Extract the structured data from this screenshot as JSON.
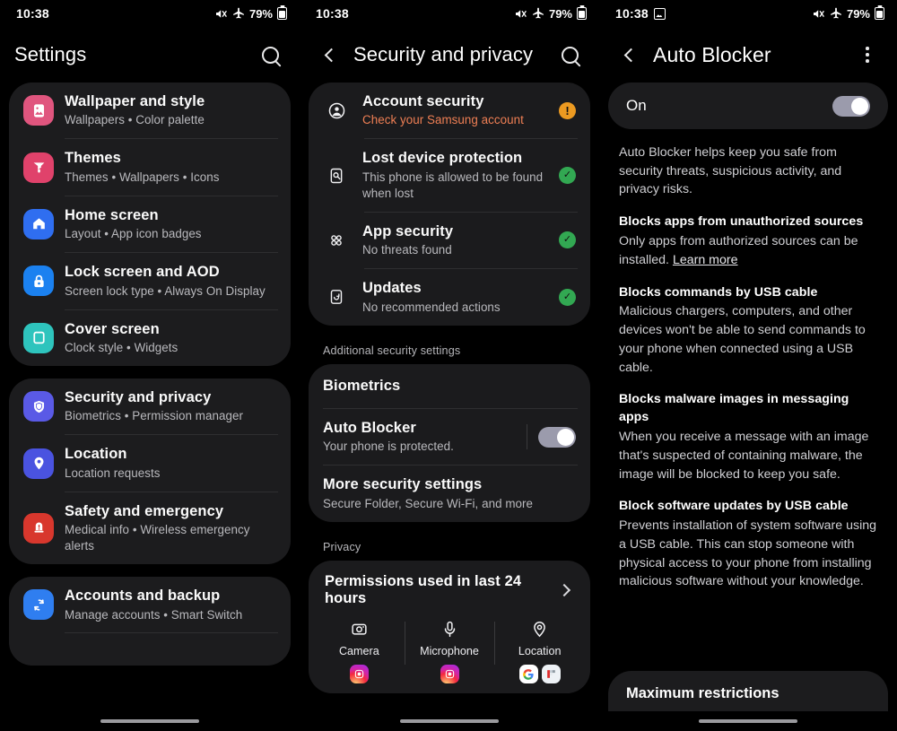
{
  "statusbar": {
    "time": "10:38",
    "battery": "79%",
    "icons": [
      "mute-icon",
      "airplane-mode-icon",
      "battery-icon"
    ],
    "panel3_extra_icon": "screenshot-icon"
  },
  "panel1": {
    "title": "Settings",
    "search_icon": "search-icon",
    "groups": [
      {
        "items": [
          {
            "title": "Wallpaper and style",
            "subtitle": "Wallpapers  •  Color palette",
            "icon": "wallpaper-icon",
            "color": "#e0557e"
          },
          {
            "title": "Themes",
            "subtitle": "Themes  •  Wallpapers  •  Icons",
            "icon": "themes-icon",
            "color": "#e0426b"
          },
          {
            "title": "Home screen",
            "subtitle": "Layout  •  App icon badges",
            "icon": "home-icon",
            "color": "#2f6ef0"
          },
          {
            "title": "Lock screen and AOD",
            "subtitle": "Screen lock type  •  Always On Display",
            "icon": "lock-icon",
            "color": "#1b81f0"
          },
          {
            "title": "Cover screen",
            "subtitle": "Clock style  •  Widgets",
            "icon": "cover-screen-icon",
            "color": "#2ec4bd"
          }
        ]
      },
      {
        "items": [
          {
            "title": "Security and privacy",
            "subtitle": "Biometrics  •  Permission manager",
            "icon": "shield-icon",
            "color": "#5a5ae6"
          },
          {
            "title": "Location",
            "subtitle": "Location requests",
            "icon": "location-pin-icon",
            "color": "#4a53e0"
          },
          {
            "title": "Safety and emergency",
            "subtitle": "Medical info  •  Wireless emergency alerts",
            "icon": "emergency-icon",
            "color": "#d8372d"
          }
        ]
      },
      {
        "items": [
          {
            "title": "Accounts and backup",
            "subtitle": "Manage accounts  •  Smart Switch",
            "icon": "sync-icon",
            "color": "#2f7ef0"
          }
        ]
      }
    ]
  },
  "panel2": {
    "title": "Security and privacy",
    "back_icon": "back-arrow-icon",
    "search_icon": "search-icon",
    "status_items": [
      {
        "title": "Account security",
        "subtitle": "Check your Samsung account",
        "subtitle_state": "warn",
        "icon": "account-circle-icon",
        "status": "warn",
        "status_glyph": "!"
      },
      {
        "title": "Lost device protection",
        "subtitle": "This phone is allowed to be found when lost",
        "subtitle_state": "normal",
        "icon": "find-device-icon",
        "status": "ok",
        "status_glyph": "✓"
      },
      {
        "title": "App security",
        "subtitle": "No threats found",
        "subtitle_state": "normal",
        "icon": "apps-grid-icon",
        "status": "ok",
        "status_glyph": "✓"
      },
      {
        "title": "Updates",
        "subtitle": "No recommended actions",
        "subtitle_state": "normal",
        "icon": "update-icon",
        "status": "ok",
        "status_glyph": "✓"
      }
    ],
    "additional_label": "Additional security settings",
    "additional_items": [
      {
        "title": "Biometrics",
        "subtitle": "",
        "toggle": false
      },
      {
        "title": "Auto Blocker",
        "subtitle": "Your phone is protected.",
        "toggle": true,
        "toggle_on": true
      },
      {
        "title": "More security settings",
        "subtitle": "Secure Folder, Secure Wi-Fi, and more",
        "toggle": false
      }
    ],
    "privacy_label": "Privacy",
    "permissions": {
      "header": "Permissions used in last 24 hours",
      "chevron_icon": "chevron-right-icon",
      "columns": [
        {
          "name": "Camera",
          "icon": "camera-icon",
          "apps": [
            "instagram-app-icon"
          ]
        },
        {
          "name": "Microphone",
          "icon": "microphone-icon",
          "apps": [
            "instagram-app-icon"
          ]
        },
        {
          "name": "Location",
          "icon": "location-pin-icon",
          "apps": [
            "google-app-icon",
            "flipboard-app-icon"
          ]
        }
      ]
    }
  },
  "panel3": {
    "title": "Auto Blocker",
    "back_icon": "back-arrow-icon",
    "menu_icon": "more-options-icon",
    "toggle_label": "On",
    "toggle_on": true,
    "intro": "Auto Blocker helps keep you safe from security threats, suspicious activity, and privacy risks.",
    "features": [
      {
        "heading": "Blocks apps from unauthorized sources",
        "body": "Only apps from authorized sources can be installed. ",
        "link": "Learn more"
      },
      {
        "heading": "Blocks commands by USB cable",
        "body": "Malicious chargers, computers, and other devices won't be able to send commands to your phone when connected using a USB cable.",
        "link": ""
      },
      {
        "heading": "Blocks malware images in messaging apps",
        "body": "When you receive a message with an image that's suspected of containing malware, the image will be blocked to keep you safe.",
        "link": ""
      },
      {
        "heading": "Block software updates by USB cable",
        "body": "Prevents installation of system software using a USB cable. This can stop someone with physical access to your phone from installing malicious software without your knowledge.",
        "link": ""
      }
    ],
    "bottom_card_title": "Maximum restrictions"
  },
  "colors": {
    "background": "#000000",
    "card": "#1c1c1e",
    "title_text": "#fafafa",
    "sub_text": "#b9b9bd",
    "warn": "#ef7f54",
    "ok_green": "#32a852",
    "warn_amber": "#ec9a21",
    "toggle_on": "#9b9bac"
  }
}
